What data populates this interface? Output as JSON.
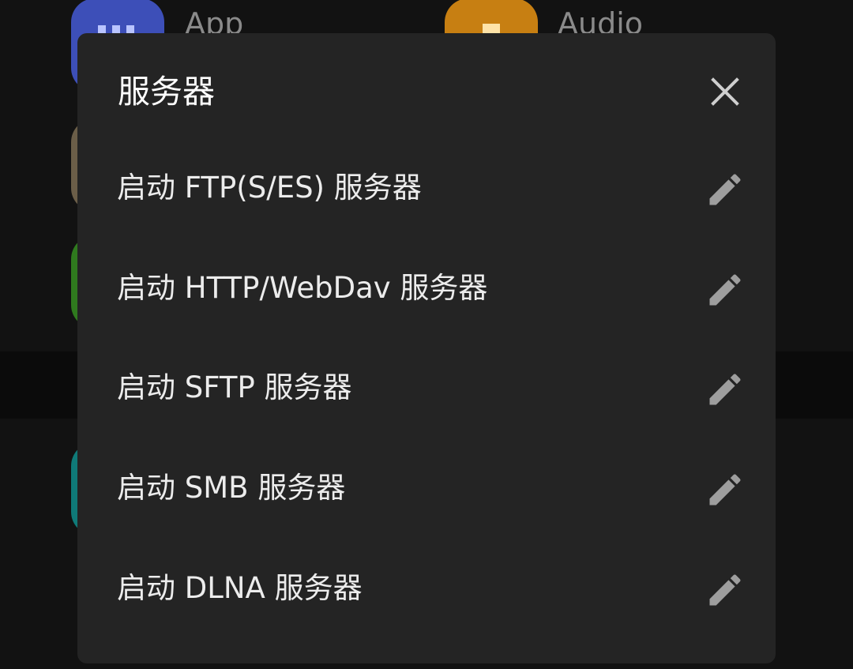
{
  "background": {
    "apps": [
      {
        "label": "App",
        "color": "#3d4fb8"
      },
      {
        "label": "Audio",
        "color": "#c77f12"
      }
    ],
    "partial_tiles": [
      {
        "color": "#6b5e48"
      },
      {
        "color": "#2f7a1e"
      },
      {
        "color": "#0f7a78"
      }
    ]
  },
  "dialog": {
    "title": "服务器",
    "close_icon": "close-icon",
    "items": [
      {
        "label": "启动 FTP(S/ES) 服务器",
        "icon": "edit-pencil-icon"
      },
      {
        "label": "启动 HTTP/WebDav 服务器",
        "icon": "edit-pencil-icon"
      },
      {
        "label": "启动 SFTP 服务器",
        "icon": "edit-pencil-icon"
      },
      {
        "label": "启动 SMB 服务器",
        "icon": "edit-pencil-icon"
      },
      {
        "label": "启动 DLNA 服务器",
        "icon": "edit-pencil-icon"
      }
    ]
  },
  "colors": {
    "dialog_bg": "#242424",
    "text": "#ececec",
    "icon": "#9e9e9e"
  }
}
